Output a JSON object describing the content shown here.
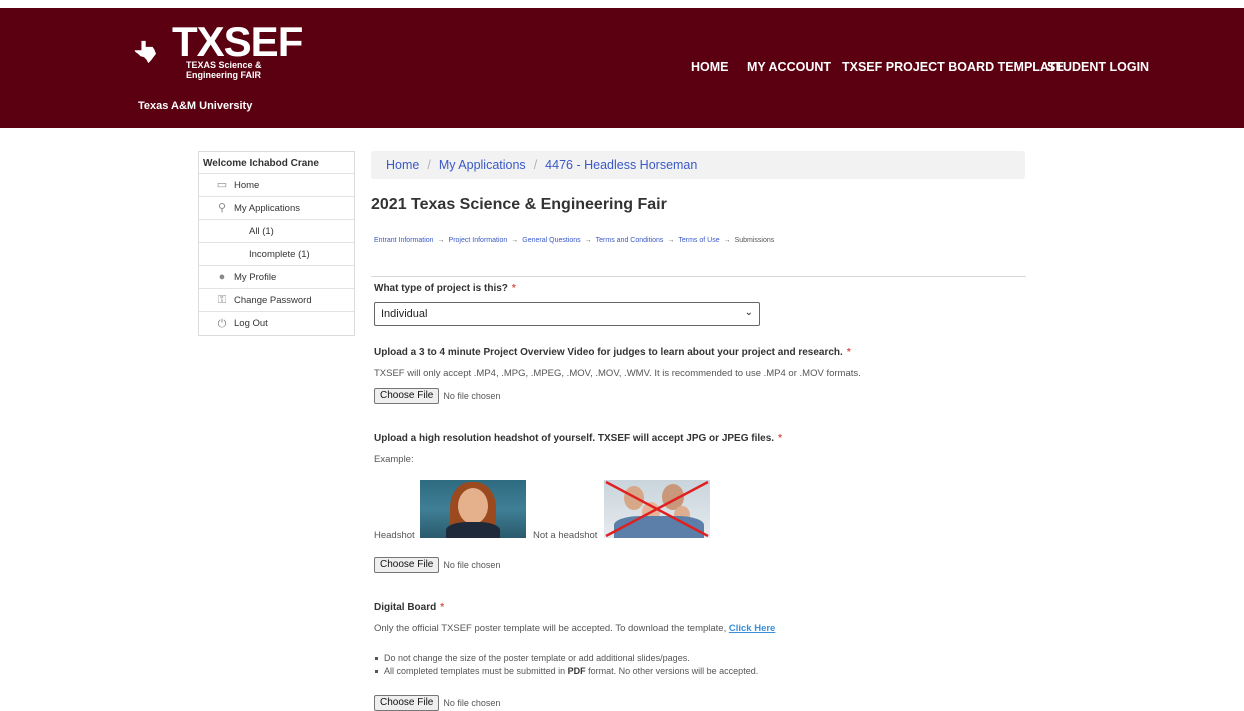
{
  "header": {
    "logo_text": "TXSEF",
    "logo_sub_line1": "TEXAS Science &",
    "logo_sub_line2": "Engineering FAIR",
    "university": "Texas A&M University",
    "bg_color": "#5a0010",
    "nav": [
      "HOME",
      "MY ACCOUNT",
      "TXSEF PROJECT BOARD TEMPLATE",
      "STUDENT LOGIN"
    ]
  },
  "sidebar": {
    "welcome": "Welcome Ichabod Crane",
    "items": [
      {
        "label": "Home",
        "icon": "home-icon"
      },
      {
        "label": "My Applications",
        "icon": "applications-icon"
      },
      {
        "label": "All (1)",
        "icon": ""
      },
      {
        "label": "Incomplete (1)",
        "icon": ""
      },
      {
        "label": "My Profile",
        "icon": "profile-icon"
      },
      {
        "label": "Change Password",
        "icon": "key-icon"
      },
      {
        "label": "Log Out",
        "icon": "power-icon"
      }
    ]
  },
  "breadcrumb": [
    "Home",
    "My Applications",
    "4476 - Headless Horseman"
  ],
  "page_title": "2021 Texas Science & Engineering Fair",
  "steps": [
    "Entrant Information",
    "Project Information",
    "General Questions",
    "Terms and Conditions",
    "Terms of Use",
    "Submissions"
  ],
  "step_arrow": "→",
  "form": {
    "project_type": {
      "label": "What type of project is this?",
      "required": "*",
      "value": "Individual"
    },
    "video": {
      "label": "Upload a 3 to 4 minute Project Overview Video for judges to learn about your project and research.",
      "required": "*",
      "help": "TXSEF will only accept .MP4, .MPG, .MPEG, .MOV, .MOV, .WMV. It is recommended to use .MP4 or .MOV formats.",
      "button": "Choose File",
      "status": "No file chosen"
    },
    "headshot": {
      "label": "Upload a high resolution headshot of yourself. TXSEF will accept JPG or JPEG files.",
      "required": "*",
      "example_label": "Example:",
      "caption_good": "Headshot",
      "caption_bad": "Not a headshot",
      "button": "Choose File",
      "status": "No file chosen"
    },
    "digital_board": {
      "label": "Digital Board",
      "required": "*",
      "help": "Only the official TXSEF poster template will be accepted. To download the template,",
      "link": "Click Here",
      "bullet1": "Do not change the size of the poster template or add additional slides/pages.",
      "bullet2_pre": "All completed templates must be submitted in",
      "bullet2_bold": "PDF",
      "bullet2_post": "format. No other versions will be accepted.",
      "button": "Choose File",
      "status": "No file chosen"
    }
  }
}
